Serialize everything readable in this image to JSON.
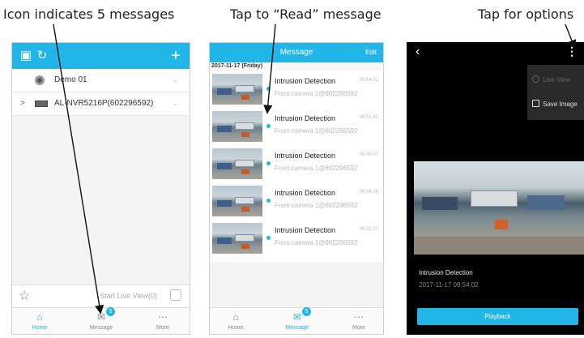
{
  "captions": {
    "left": "Icon indicates 5 messages",
    "middle": "Tap to “Read” message",
    "right": "Tap for options"
  },
  "home": {
    "devices": [
      {
        "name": "Demo 01",
        "icon": "camera-icon"
      },
      {
        "name": "AL-NVR5216P(602296592)",
        "icon": "nvr-icon"
      }
    ],
    "start_live_view": "Start Live View(0)",
    "tabs": [
      {
        "label": "Home",
        "icon": "home-icon"
      },
      {
        "label": "Message",
        "icon": "envelope-icon",
        "badge": "5"
      },
      {
        "label": "More",
        "icon": "more-dots-icon"
      }
    ],
    "accent_color": "#21b5e8"
  },
  "message": {
    "title": "Message",
    "edit": "Edit",
    "date": "2017-11-17 (Friday)",
    "items": [
      {
        "title": "Intrusion Detection",
        "source": "From:camera 1@602296592",
        "time": "09:54:02"
      },
      {
        "title": "Intrusion Detection",
        "source": "From:camera 1@602296592",
        "time": "09:51:42"
      },
      {
        "title": "Intrusion Detection",
        "source": "From:camera 1@602296592",
        "time": "09:45:07"
      },
      {
        "title": "Intrusion Detection",
        "source": "From:camera 1@602296592",
        "time": "09:34:38"
      },
      {
        "title": "Intrusion Detection",
        "source": "From:camera 1@602296592",
        "time": "09:32:27"
      }
    ],
    "tabs": [
      {
        "label": "Home",
        "icon": "home-icon"
      },
      {
        "label": "Message",
        "icon": "envelope-icon",
        "badge": "5"
      },
      {
        "label": "More",
        "icon": "more-dots-icon"
      }
    ]
  },
  "detail": {
    "options": [
      "Live View",
      "Save Image"
    ],
    "event_title": "Intrusion Detection",
    "event_time": "2017-11-17 09:54:02",
    "playback": "Playback"
  }
}
